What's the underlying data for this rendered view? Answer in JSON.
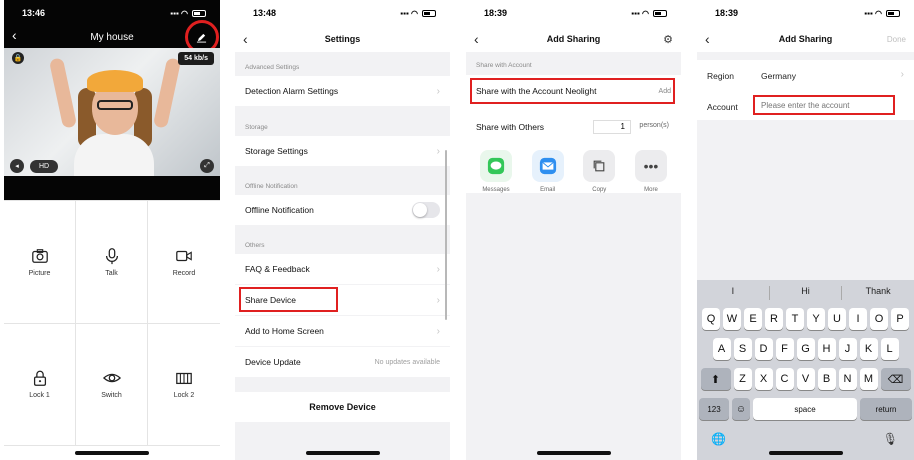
{
  "panel1": {
    "time": "13:46",
    "title": "My house",
    "speed": "54 kb/s",
    "hd": "HD",
    "controls": [
      {
        "label": "Picture",
        "icon": "camera-icon"
      },
      {
        "label": "Talk",
        "icon": "microphone-icon"
      },
      {
        "label": "Record",
        "icon": "video-camera-icon"
      },
      {
        "label": "Lock 1",
        "icon": "lock-icon"
      },
      {
        "label": "Switch",
        "icon": "eye-icon"
      },
      {
        "label": "Lock 2",
        "icon": "gate-icon"
      }
    ]
  },
  "panel2": {
    "time": "13:48",
    "title": "Settings",
    "sections": {
      "advanced": "Advanced Settings",
      "storage": "Storage",
      "offline": "Offline Notification",
      "others": "Others"
    },
    "rows": {
      "detection": "Detection Alarm Settings",
      "storage_settings": "Storage Settings",
      "offline_notification": "Offline Notification",
      "faq": "FAQ & Feedback",
      "share": "Share Device",
      "home_screen": "Add to Home Screen",
      "update": "Device Update",
      "update_status": "No updates available"
    },
    "remove": "Remove Device"
  },
  "panel3": {
    "time": "18:39",
    "title": "Add Sharing",
    "section": "Share with Account",
    "share_account": "Share with the Account Neolight",
    "add": "Add",
    "share_others": "Share with Others",
    "count": "1",
    "persons": "person(s)",
    "apps": [
      {
        "label": "Messages",
        "icon": "messages-icon"
      },
      {
        "label": "Email",
        "icon": "email-icon"
      },
      {
        "label": "Copy",
        "icon": "copy-icon"
      },
      {
        "label": "More",
        "icon": "more-icon"
      }
    ]
  },
  "panel4": {
    "time": "18:39",
    "title": "Add Sharing",
    "done": "Done",
    "region_label": "Region",
    "region_value": "Germany",
    "account_label": "Account",
    "account_placeholder": "Please enter the account",
    "suggestions": [
      "I",
      "Hi",
      "Thank"
    ],
    "row1": [
      "Q",
      "W",
      "E",
      "R",
      "T",
      "Y",
      "U",
      "I",
      "O",
      "P"
    ],
    "row2": [
      "A",
      "S",
      "D",
      "F",
      "G",
      "H",
      "J",
      "K",
      "L"
    ],
    "row3": [
      "Z",
      "X",
      "C",
      "V",
      "B",
      "N",
      "M"
    ],
    "key_123": "123",
    "key_space": "space",
    "key_return": "return"
  },
  "colors": {
    "highlight": "#e02020"
  }
}
